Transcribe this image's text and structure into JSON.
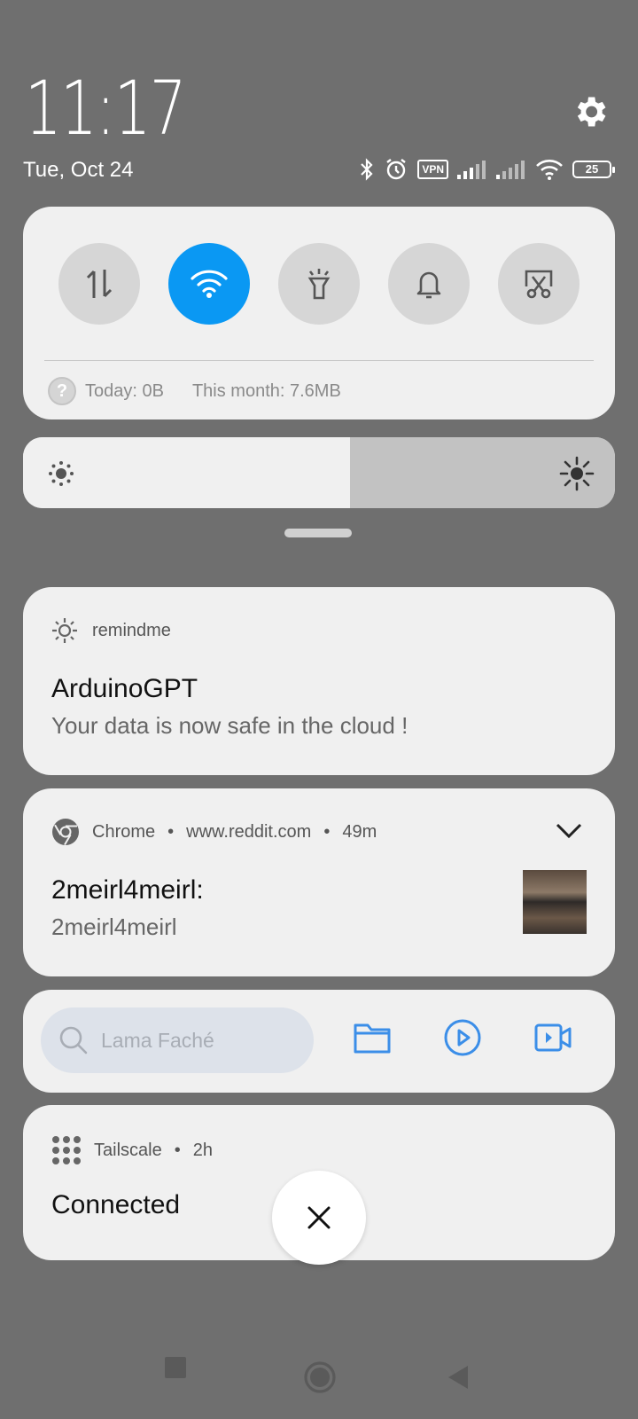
{
  "header": {
    "time": "11:17",
    "date": "Tue, Oct 24",
    "status": {
      "vpn_label": "VPN",
      "battery_level": "25"
    }
  },
  "quick_settings": {
    "toggles": [
      {
        "name": "mobile-data",
        "icon": "data-transfer-icon",
        "active": false
      },
      {
        "name": "wifi",
        "icon": "wifi-icon",
        "active": true
      },
      {
        "name": "flashlight",
        "icon": "flashlight-icon",
        "active": false
      },
      {
        "name": "sound",
        "icon": "bell-icon",
        "active": false
      },
      {
        "name": "screenshot",
        "icon": "scissors-icon",
        "active": false
      }
    ],
    "data_usage": {
      "today": "Today: 0B",
      "month": "This month: 7.6MB"
    },
    "brightness_level": 0.55,
    "accent_color": "#0a98f3"
  },
  "notifications": [
    {
      "app": "remindme",
      "title": "ArduinoGPT",
      "text": "Your data is now safe in the cloud !"
    },
    {
      "app": "Chrome",
      "source": "www.reddit.com",
      "time": "49m",
      "title": "2meirl4meirl:",
      "text": "2meirl4meirl"
    },
    {
      "app": "Tailscale",
      "time": "2h",
      "title": "Connected"
    }
  ],
  "media_widget": {
    "search_placeholder": "Lama Faché"
  },
  "separator": "•"
}
